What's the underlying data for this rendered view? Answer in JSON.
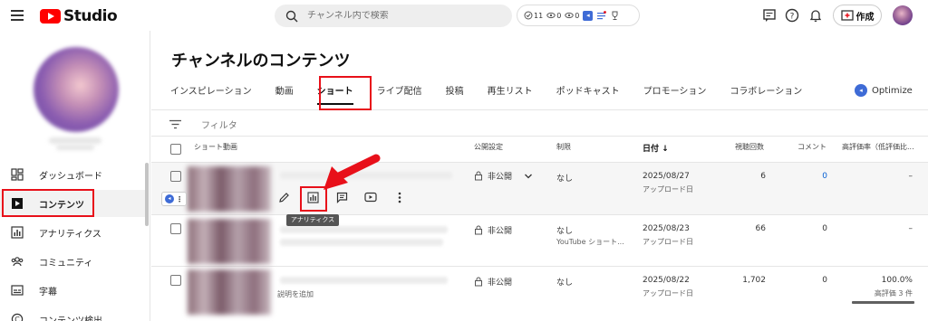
{
  "header": {
    "logo_text": "Studio",
    "search_placeholder": "チャンネル内で検索",
    "stats": [
      {
        "icon": "checklist-icon",
        "value": "11"
      },
      {
        "icon": "eye-icon",
        "value": "0"
      },
      {
        "icon": "eye-icon",
        "value": "0"
      }
    ],
    "create_label": "作成"
  },
  "sidebar": {
    "items": [
      {
        "label": "ダッシュボード",
        "icon": "dashboard-icon"
      },
      {
        "label": "コンテンツ",
        "icon": "content-icon"
      },
      {
        "label": "アナリティクス",
        "icon": "analytics-icon"
      },
      {
        "label": "コミュニティ",
        "icon": "community-icon"
      },
      {
        "label": "字幕",
        "icon": "subtitles-icon"
      },
      {
        "label": "コンテンツ検出",
        "icon": "copyright-icon"
      }
    ]
  },
  "main": {
    "title": "チャンネルのコンテンツ",
    "tabs": [
      "インスピレーション",
      "動画",
      "ショート",
      "ライブ配信",
      "投稿",
      "再生リスト",
      "ポッドキャスト",
      "プロモーション",
      "コラボレーション"
    ],
    "active_tab": "ショート",
    "optimize_label": "Optimize",
    "filter_label": "フィルタ",
    "columns": {
      "video": "ショート動画",
      "visibility": "公開設定",
      "restriction": "制限",
      "date": "日付",
      "views": "視聴回数",
      "comments": "コメント",
      "likes": "高評価率（低評価比..."
    },
    "rows": [
      {
        "visibility": "非公開",
        "restriction": "なし",
        "restriction_sub": "",
        "date": "2025/08/27",
        "date_sub": "アップロード日",
        "views": "6",
        "comments": "0",
        "likes": "–",
        "likes_sub": ""
      },
      {
        "visibility": "非公開",
        "restriction": "なし",
        "restriction_sub": "YouTube ショート...",
        "date": "2025/08/23",
        "date_sub": "アップロード日",
        "views": "66",
        "comments": "0",
        "likes": "–",
        "likes_sub": ""
      },
      {
        "visibility": "非公開",
        "restriction": "なし",
        "restriction_sub": "",
        "date": "2025/08/22",
        "date_sub": "アップロード日",
        "views": "1,702",
        "comments": "0",
        "likes": "100.0%",
        "likes_sub": "高評価 3 件"
      }
    ],
    "row3_desc_hint": "説明を追加",
    "tooltip": "アナリティクス",
    "sort_arrow": "↓"
  },
  "colors": {
    "accent_red": "#e8101a",
    "brand_red": "#ff0000",
    "link_blue": "#065fd4",
    "optimize_blue": "#3e6bd6"
  }
}
